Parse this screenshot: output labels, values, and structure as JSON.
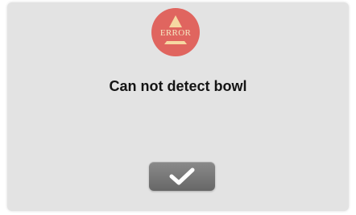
{
  "dialog": {
    "badge_text": "ERROR",
    "badge_icon": "warning-triangle-icon",
    "message": "Can not detect bowl",
    "confirm_icon": "checkmark-icon"
  },
  "colors": {
    "dialog_bg": "#e3e3e3",
    "badge_bg": "#e0655f",
    "badge_fg": "#f6e7c2",
    "button_bg": "#777777"
  }
}
